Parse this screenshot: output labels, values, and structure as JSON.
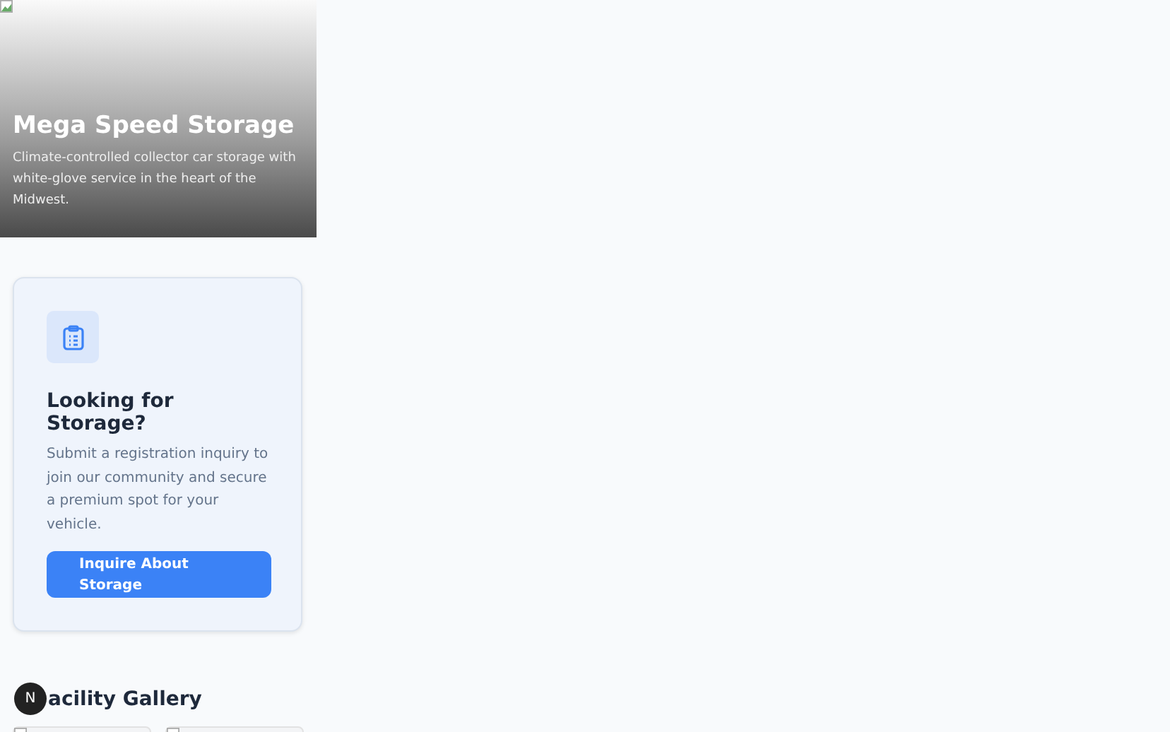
{
  "hero": {
    "title": "Mega Speed Storage",
    "subtitle": "Climate-controlled collector car storage with white-glove service in the heart of the Midwest."
  },
  "inquiry_card": {
    "title": "Looking for Storage?",
    "text": "Submit a registration inquiry to join our community and secure a premium spot for your vehicle.",
    "button": "Inquire About Storage"
  },
  "gallery": {
    "badge": "N",
    "title": "acility Gallery",
    "tiles": [
      {
        "kind": "broken-image"
      },
      {
        "kind": "broken-image"
      }
    ]
  }
}
